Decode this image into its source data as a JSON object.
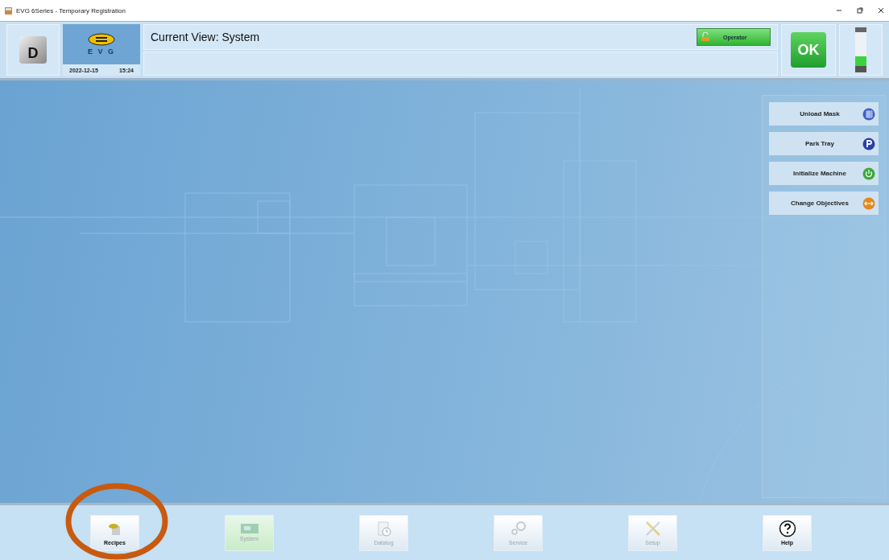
{
  "window": {
    "title": "EVG 6Series - Temporary Registration"
  },
  "header": {
    "mode_key": "D",
    "logo_text": "E V G",
    "date": "2022-12-15",
    "time": "15:24",
    "current_view": "Current View: System",
    "user_button": "Operator",
    "status_button": "OK"
  },
  "actions": [
    {
      "label": "Unload Mask",
      "kind": "mask"
    },
    {
      "label": "Park Tray",
      "kind": "park"
    },
    {
      "label": "Initialize Machine",
      "kind": "power"
    },
    {
      "label": "Change Objectives",
      "kind": "objective"
    }
  ],
  "nav": [
    {
      "label": "Recipes",
      "kind": "recipes",
      "selected": false,
      "disabled": false
    },
    {
      "label": "System",
      "kind": "system",
      "selected": true,
      "disabled": true
    },
    {
      "label": "Datalog",
      "kind": "datalog",
      "selected": false,
      "disabled": true
    },
    {
      "label": "Service",
      "kind": "service",
      "selected": false,
      "disabled": true
    },
    {
      "label": "Setup",
      "kind": "setup",
      "selected": false,
      "disabled": true
    },
    {
      "label": "Help",
      "kind": "help",
      "selected": false,
      "disabled": false
    }
  ]
}
